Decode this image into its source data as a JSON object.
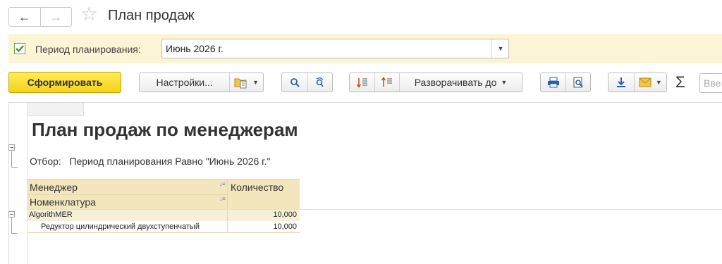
{
  "window": {
    "title": "План продаж",
    "back_icon": "←",
    "forward_icon": "→",
    "favorite_icon": "☆"
  },
  "period": {
    "checked": true,
    "label": "Период планирования:",
    "value": "Июнь 2026 г."
  },
  "toolbar": {
    "generate_label": "Сформировать",
    "settings_label": "Настройки...",
    "expand_label": "Разворачивать до",
    "sum_icon": "Σ",
    "search_placeholder": "Вве"
  },
  "report": {
    "title": "План продаж по менеджерам",
    "filter_text": "Отбор:   Период планирования Равно \"Июнь 2026 г.\"",
    "headers": {
      "manager": "Менеджер",
      "nomenclature": "Номенклатура",
      "quantity": "Количество"
    },
    "rows": [
      {
        "name": "AlgorithMER",
        "quantity": "10,000"
      },
      {
        "name": "Редуктор цилиндрический двухступенчатый",
        "quantity": "10,000"
      }
    ]
  },
  "colors": {
    "accent_yellow": "#f5d21c",
    "header_fill": "#f3e6bd",
    "panel_fill": "#fbf5d6",
    "checkbox_green": "#3f8f2a"
  }
}
